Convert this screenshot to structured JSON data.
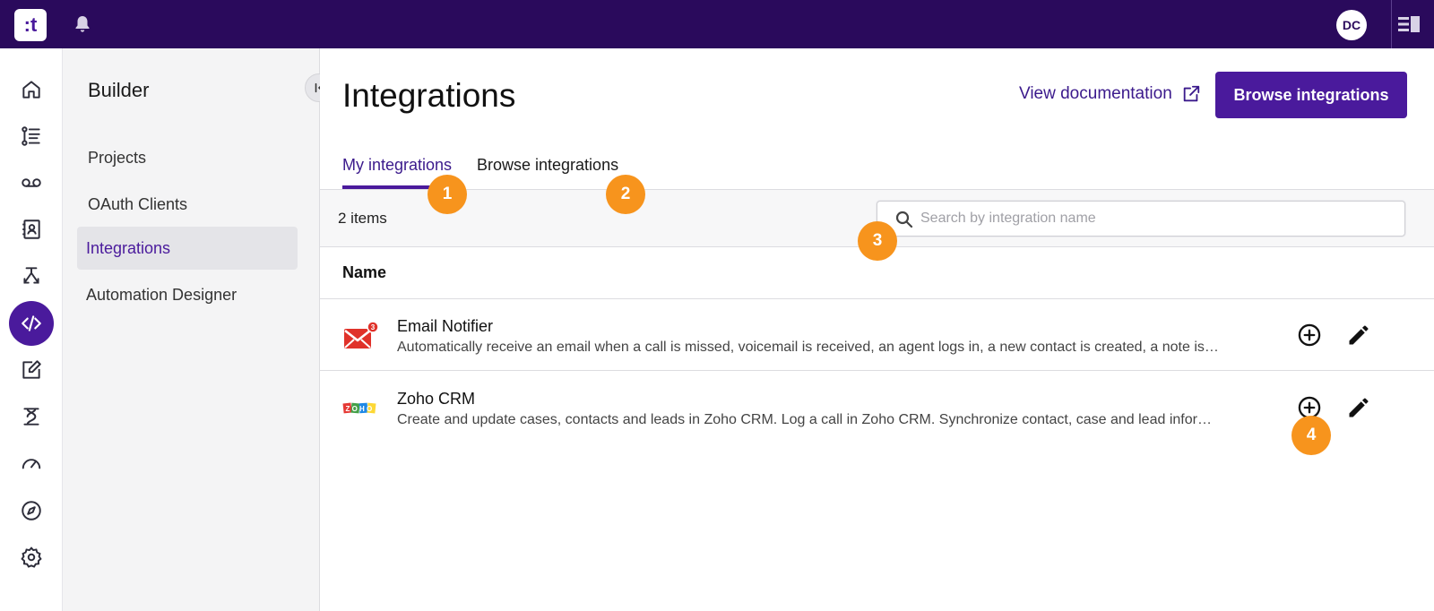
{
  "topbar": {
    "logo_text": ":t",
    "avatar_initials": "DC",
    "icons": [
      "notifications-bell-icon",
      "side-panel-toggle-icon"
    ]
  },
  "rail": {
    "items": [
      {
        "name": "home-icon"
      },
      {
        "name": "list-icon"
      },
      {
        "name": "voicemail-icon"
      },
      {
        "name": "contacts-icon"
      },
      {
        "name": "routing-icon"
      },
      {
        "name": "code-icon",
        "active": true
      },
      {
        "name": "edit-note-icon"
      },
      {
        "name": "agent-icon"
      },
      {
        "name": "dashboard-gauge-icon"
      },
      {
        "name": "compass-icon"
      },
      {
        "name": "settings-gear-icon"
      }
    ]
  },
  "sidebar": {
    "title": "Builder",
    "items": [
      {
        "label": "Projects"
      },
      {
        "label": "OAuth Clients"
      },
      {
        "label": "Integrations",
        "active": true
      },
      {
        "label": "Automation Designer"
      }
    ]
  },
  "main": {
    "title": "Integrations",
    "doc_link": "View documentation",
    "browse_button": "Browse integrations",
    "tabs": [
      {
        "label": "My integrations",
        "active": true
      },
      {
        "label": "Browse integrations"
      }
    ],
    "item_count": "2 items",
    "search": {
      "placeholder": "Search by integration name",
      "value": ""
    },
    "column_header": "Name",
    "rows": [
      {
        "name": "Email Notifier",
        "description": "Automatically receive an email when a call is missed, voicemail is received, an agent logs in, a new contact is created, a note is cre…",
        "logo": "email-envelope-icon",
        "badge": "3"
      },
      {
        "name": "Zoho CRM",
        "description": "Create and update cases, contacts and leads in Zoho CRM. Log a call in Zoho CRM. Synchronize contact, case and lead informatio…",
        "logo": "zoho-logo-icon",
        "logo_text": "ZOHO"
      }
    ]
  },
  "markers": [
    "1",
    "2",
    "3",
    "4"
  ],
  "colors": {
    "topbar": "#2a0a5c",
    "accent": "#4a1a9c",
    "marker": "#f7941d"
  }
}
